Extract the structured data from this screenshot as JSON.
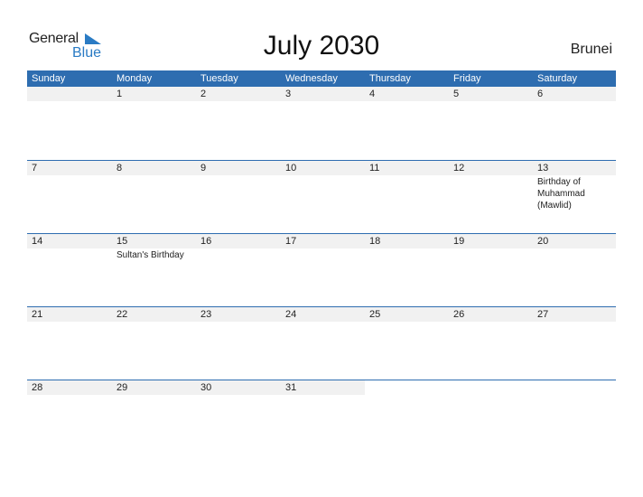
{
  "logo": {
    "general": "General",
    "blue": "Blue"
  },
  "title": "July 2030",
  "country": "Brunei",
  "colors": {
    "header_bg": "#2e6db0",
    "logo_blue": "#2a7bc4",
    "day_strip": "#f1f1f1"
  },
  "weekdays": [
    "Sunday",
    "Monday",
    "Tuesday",
    "Wednesday",
    "Thursday",
    "Friday",
    "Saturday"
  ],
  "weeks": [
    {
      "days": [
        "",
        "1",
        "2",
        "3",
        "4",
        "5",
        "6"
      ],
      "events": [
        "",
        "",
        "",
        "",
        "",
        "",
        ""
      ]
    },
    {
      "days": [
        "7",
        "8",
        "9",
        "10",
        "11",
        "12",
        "13"
      ],
      "events": [
        "",
        "",
        "",
        "",
        "",
        "",
        "Birthday of Muhammad (Mawlid)"
      ]
    },
    {
      "days": [
        "14",
        "15",
        "16",
        "17",
        "18",
        "19",
        "20"
      ],
      "events": [
        "",
        "Sultan's Birthday",
        "",
        "",
        "",
        "",
        ""
      ]
    },
    {
      "days": [
        "21",
        "22",
        "23",
        "24",
        "25",
        "26",
        "27"
      ],
      "events": [
        "",
        "",
        "",
        "",
        "",
        "",
        ""
      ]
    },
    {
      "days": [
        "28",
        "29",
        "30",
        "31",
        "",
        "",
        ""
      ],
      "events": [
        "",
        "",
        "",
        "",
        "",
        "",
        ""
      ]
    }
  ]
}
